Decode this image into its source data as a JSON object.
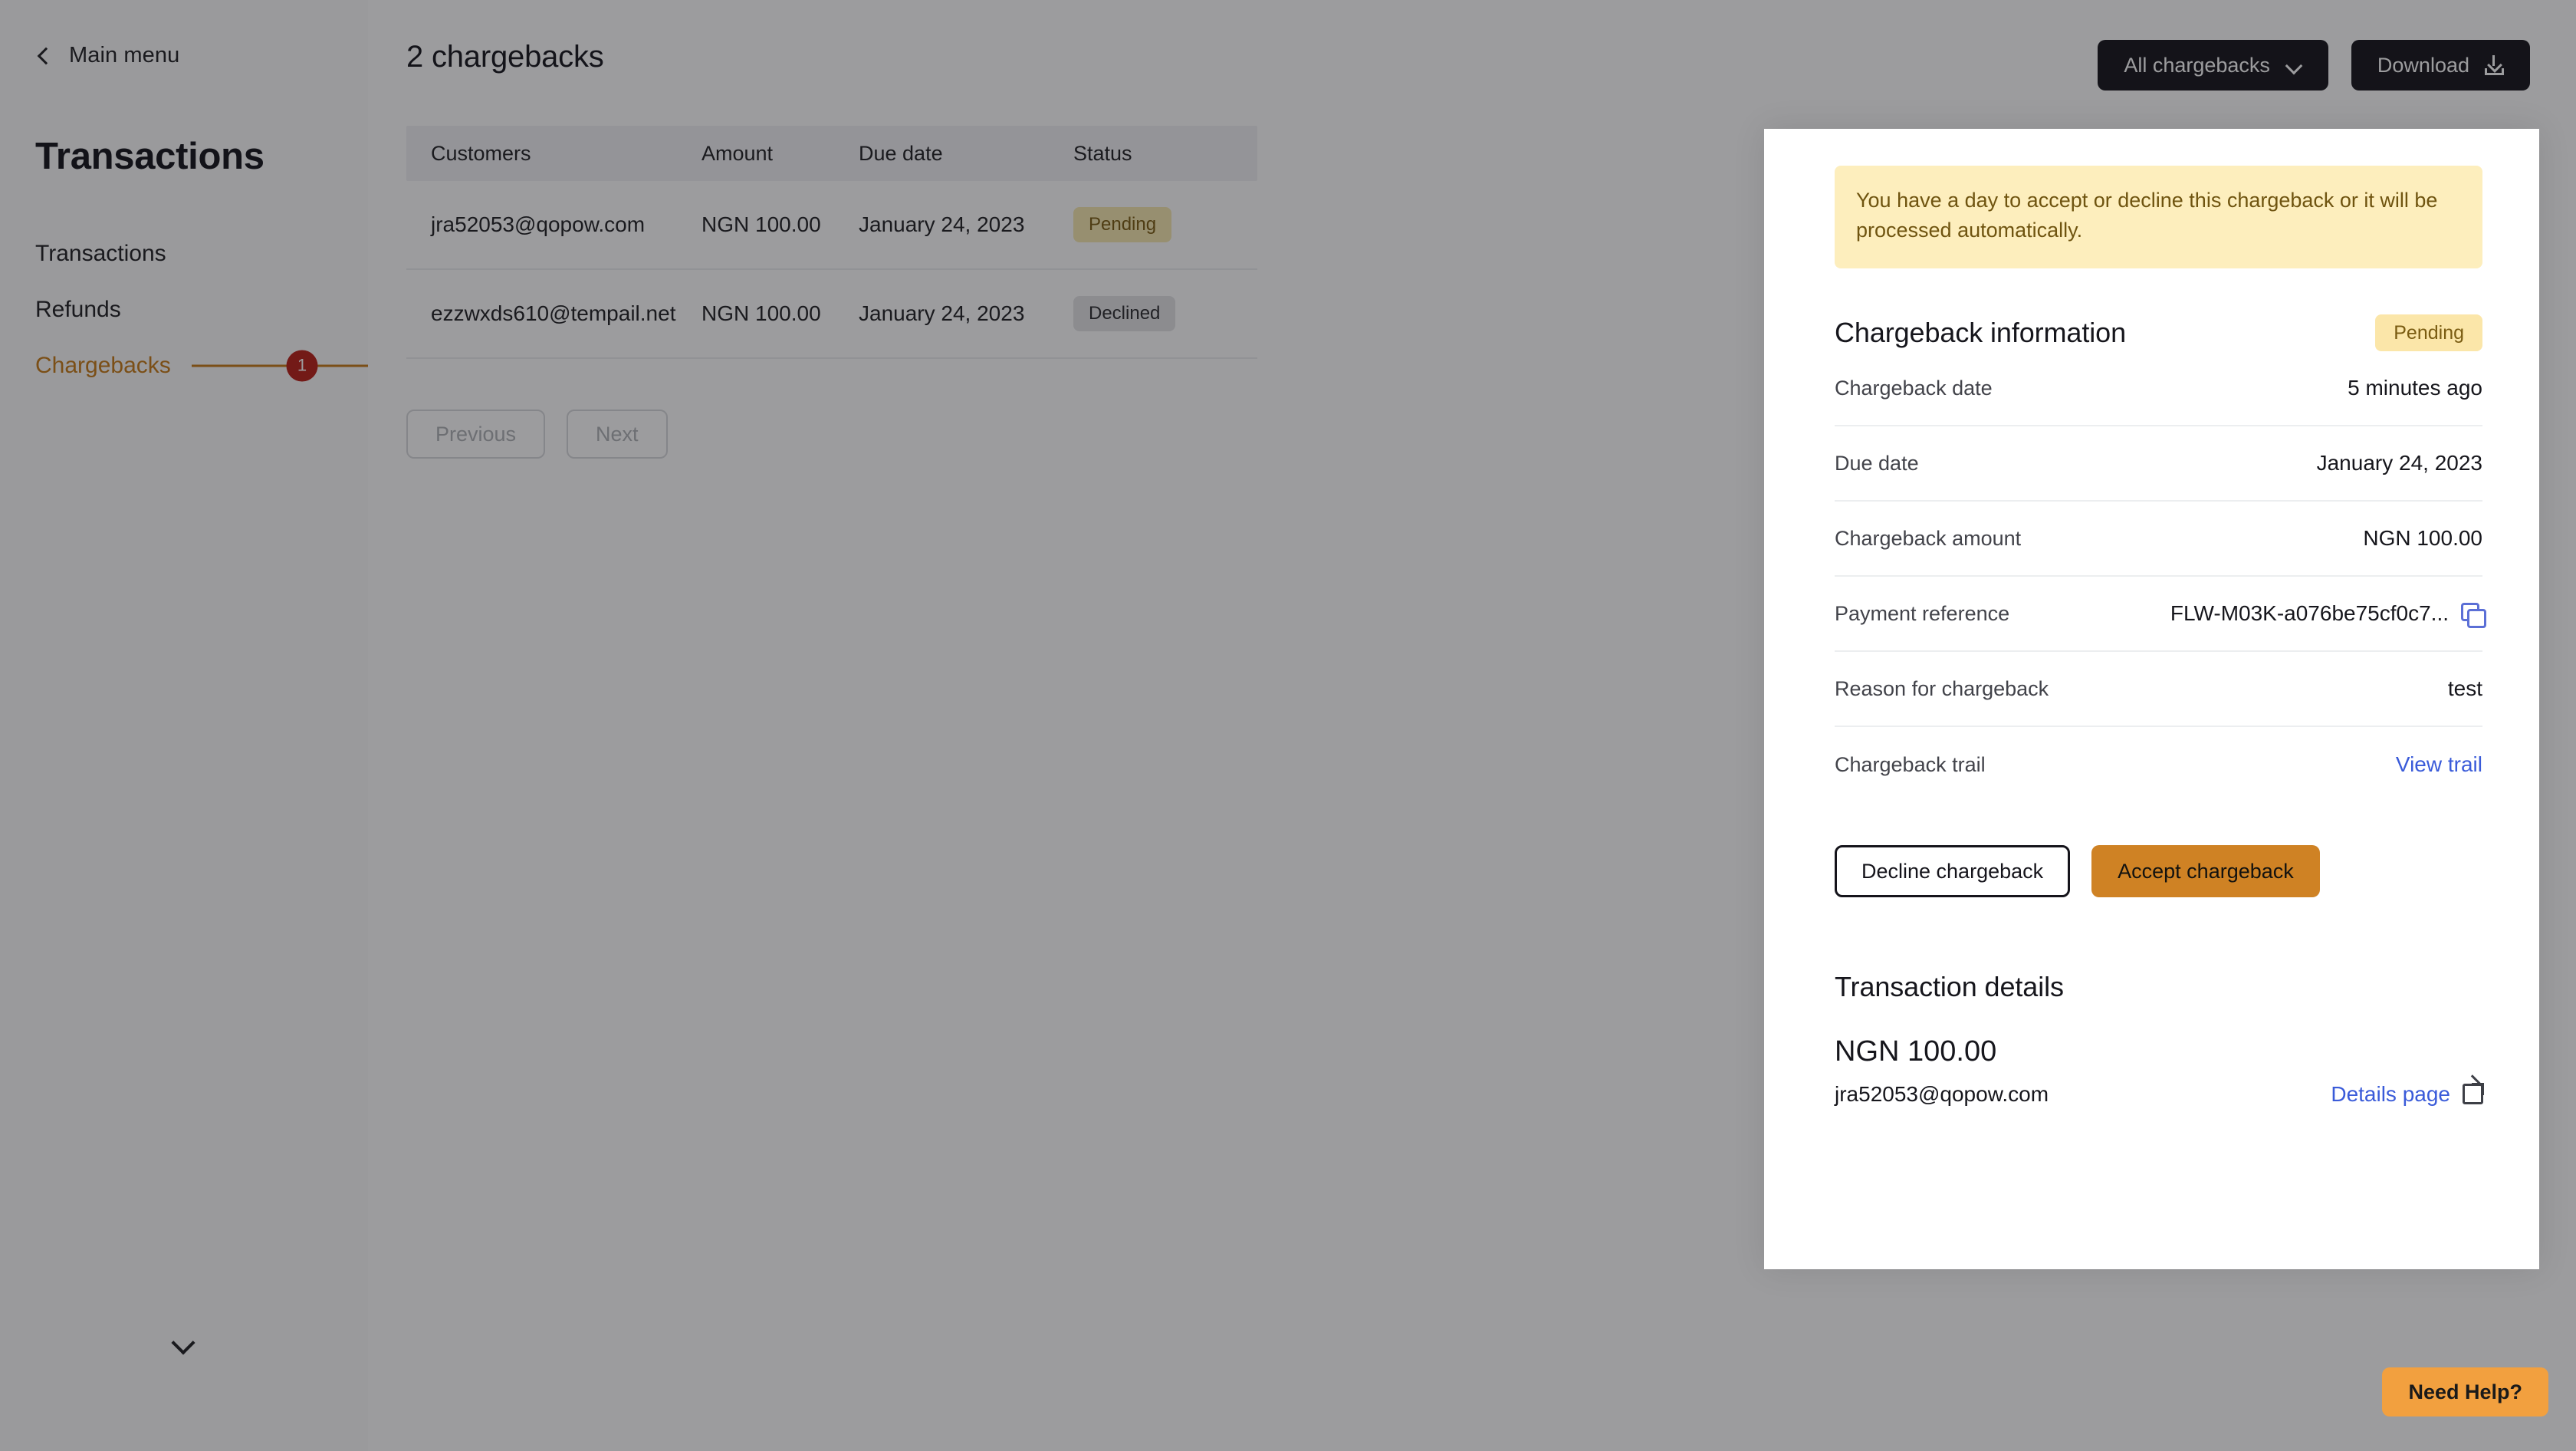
{
  "sidebar": {
    "back_label": "Main menu",
    "title": "Transactions",
    "items": [
      {
        "label": "Transactions",
        "badge": ""
      },
      {
        "label": "Refunds",
        "badge": ""
      },
      {
        "label": "Chargebacks",
        "badge": "1"
      }
    ],
    "collapse_icon": "chevron-down-icon",
    "active_color": "#c67b17",
    "badge_color": "#b81f18"
  },
  "header": {
    "title": "2 chargebacks",
    "filter_label": "All chargebacks",
    "download_label": "Download"
  },
  "table": {
    "columns": [
      "Customers",
      "Amount",
      "Due date",
      "Status"
    ],
    "rows": [
      {
        "customer": "jra52053@qopow.com",
        "amount": "NGN 100.00",
        "due_date": "January 24, 2023",
        "status": "Pending",
        "status_kind": "pending"
      },
      {
        "customer": "ezzwxds610@tempail.net",
        "amount": "NGN 100.00",
        "due_date": "January 24, 2023",
        "status": "Declined",
        "status_kind": "declined"
      }
    ]
  },
  "pagination": {
    "previous_label": "Previous",
    "next_label": "Next"
  },
  "drawer": {
    "alert": "You have a day to accept or decline this chargeback or it will be processed automatically.",
    "section_title": "Chargeback information",
    "status_badge": "Pending",
    "rows": [
      {
        "label": "Chargeback date",
        "value": "5 minutes ago"
      },
      {
        "label": "Due date",
        "value": "January 24, 2023"
      },
      {
        "label": "Chargeback amount",
        "value": "NGN 100.00"
      },
      {
        "label": "Payment reference",
        "value": "FLW-M03K-a076be75cf0c7..."
      },
      {
        "label": "Reason for chargeback",
        "value": "test"
      },
      {
        "label": "Chargeback trail",
        "value": "View trail"
      }
    ],
    "decline_label": "Decline chargeback",
    "accept_label": "Accept chargeback",
    "transaction": {
      "title": "Transaction details",
      "amount": "NGN 100.00",
      "email": "jra52053@qopow.com",
      "details_link": "Details page"
    },
    "accent_color": "#cf8224",
    "alert_bg": "#fdeebd",
    "link_color": "#3a5bd9"
  },
  "help": {
    "label": "Need Help?",
    "color": "#f2a03f"
  }
}
